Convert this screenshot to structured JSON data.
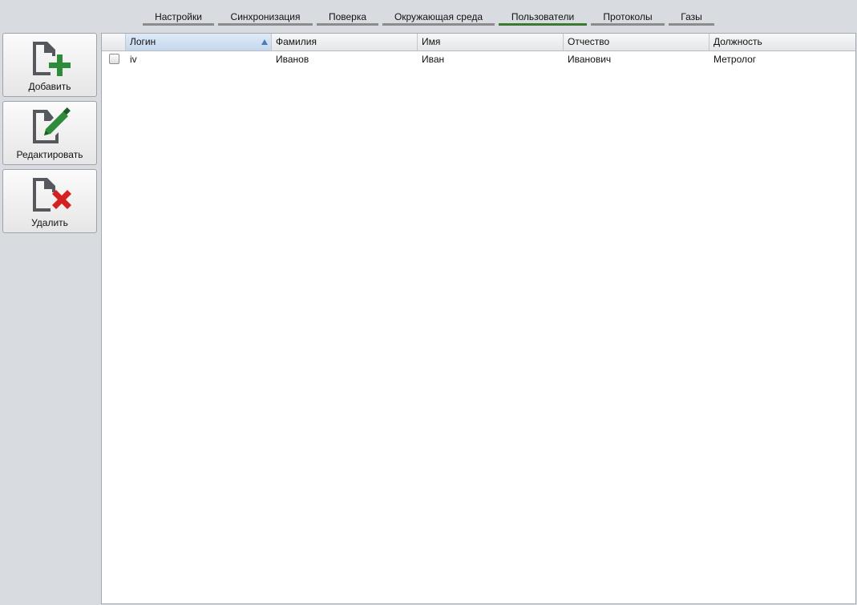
{
  "tabs": [
    {
      "label": "Настройки",
      "active": false
    },
    {
      "label": "Синхронизация",
      "active": false
    },
    {
      "label": "Поверка",
      "active": false
    },
    {
      "label": "Окружающая среда",
      "active": false
    },
    {
      "label": "Пользователи",
      "active": true
    },
    {
      "label": "Протоколы",
      "active": false
    },
    {
      "label": "Газы",
      "active": false
    }
  ],
  "sidebar": {
    "add_label": "Добавить",
    "edit_label": "Редактировать",
    "delete_label": "Удалить"
  },
  "table": {
    "columns": [
      "Логин",
      "Фамилия",
      "Имя",
      "Отчество",
      "Должность"
    ],
    "sort_column": "Логин",
    "sort_direction": "ascending",
    "rows": [
      {
        "checked": false,
        "cells": [
          "iv",
          "Иванов",
          "Иван",
          "Иванович",
          "Метролог"
        ]
      }
    ]
  },
  "colors": {
    "active_tab": "#3a7a2e",
    "inactive_tab": "#8c8c8c",
    "add_icon": "#2e8b3a",
    "edit_icon": "#2e8b3a",
    "delete_icon": "#d42020"
  }
}
